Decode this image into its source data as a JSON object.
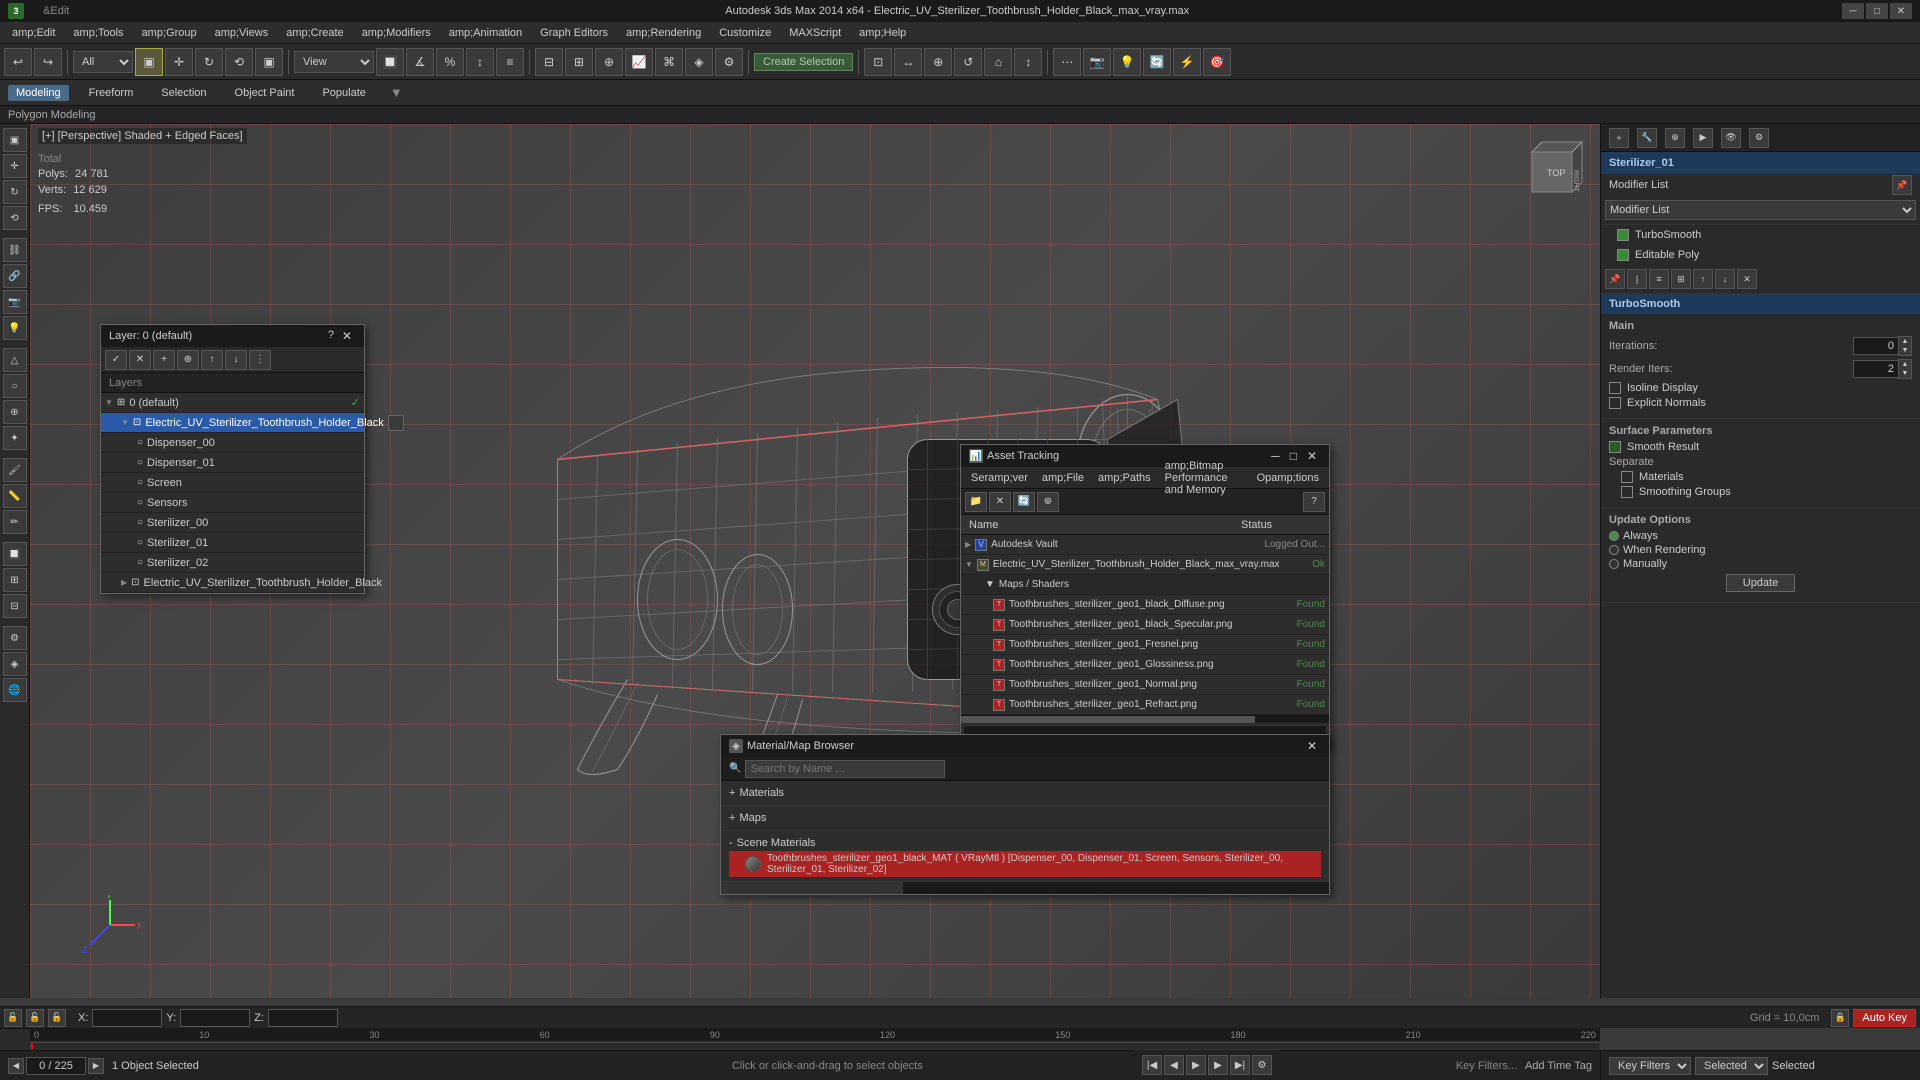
{
  "app": {
    "title": "Autodesk 3ds Max 2014 x64 - Electric_UV_Sterilizer_Toothbrush_Holder_Black_max_vray.max",
    "icon": "3dsmax-icon"
  },
  "title_bar": {
    "controls": {
      "minimize": "─",
      "maximize": "□",
      "close": "✕"
    }
  },
  "menu_bar": {
    "items": [
      "&Edit",
      "amp;Tools",
      "amp;Group",
      "amp;Views",
      "amp;Create",
      "amp;Modifiers",
      "amp;Animation",
      "Graph Editors",
      "amp;Rendering",
      "Customize",
      "MAXScript",
      "amp;Help"
    ]
  },
  "sub_toolbar": {
    "items": [
      "Modeling",
      "Freeform",
      "Selection",
      "Object Paint",
      "Populate"
    ],
    "active": "Modeling"
  },
  "poly_bar": {
    "label": "Polygon Modeling"
  },
  "viewport": {
    "label": "[+] [Perspective] Shaded + Edged Faces]",
    "stats": {
      "polys_label": "Polys:",
      "polys_value": "24 781",
      "verts_label": "Verts:",
      "verts_value": "12 629",
      "fps_label": "FPS:",
      "fps_value": "10.459",
      "total_label": "Total"
    }
  },
  "layer_dialog": {
    "title": "Layer: 0 (default)",
    "toolbar_buttons": [
      "✓",
      "✕",
      "+",
      "⊕",
      "↑",
      "↓",
      "⋮"
    ],
    "header": "Layers",
    "items": [
      {
        "id": "layer0",
        "label": "0 (default)",
        "level": 0,
        "expanded": true,
        "checked": true
      },
      {
        "id": "electric",
        "label": "Electric_UV_Sterilizer_Toothbrush_Holder_Black",
        "level": 1,
        "selected": true
      },
      {
        "id": "dispenser00",
        "label": "Dispenser_00",
        "level": 2
      },
      {
        "id": "dispenser01",
        "label": "Dispenser_01",
        "level": 2
      },
      {
        "id": "screen",
        "label": "Screen",
        "level": 2
      },
      {
        "id": "sensors",
        "label": "Sensors",
        "level": 2
      },
      {
        "id": "sterilizer00",
        "label": "Sterilizer_00",
        "level": 2
      },
      {
        "id": "sterilizer01",
        "label": "Sterilizer_01",
        "level": 2
      },
      {
        "id": "sterilizer02",
        "label": "Sterilizer_02",
        "level": 2
      },
      {
        "id": "electric2",
        "label": "Electric_UV_Sterilizer_Toothbrush_Holder_Black",
        "level": 1
      }
    ]
  },
  "asset_dialog": {
    "title": "Asset Tracking",
    "menu_items": [
      "Seramp;ver",
      "amp;File",
      "amp;Paths",
      "amp;Bitmap Performance and Memory",
      "Opamp;tions"
    ],
    "col_name": "Name",
    "col_status": "Status",
    "items": [
      {
        "id": "vault",
        "label": "Autodesk Vault",
        "level": 0,
        "type": "vault",
        "status": "Logged Out..."
      },
      {
        "id": "maxfile",
        "label": "Electric_UV_Sterilizer_Toothbrush_Holder_Black_max_vray.max",
        "level": 0,
        "type": "file",
        "status": "Ok"
      },
      {
        "id": "maps",
        "label": "Maps / Shaders",
        "level": 1,
        "type": "folder"
      },
      {
        "id": "diffuse",
        "label": "Toothbrushes_sterilizer_geo1_black_Diffuse.png",
        "level": 2,
        "type": "image",
        "status": "Found"
      },
      {
        "id": "specular",
        "label": "Toothbrushes_sterilizer_geo1_black_Specular.png",
        "level": 2,
        "type": "image",
        "status": "Found"
      },
      {
        "id": "fresnel",
        "label": "Toothbrushes_sterilizer_geo1_Fresnel.png",
        "level": 2,
        "type": "image",
        "status": "Found"
      },
      {
        "id": "glossiness",
        "label": "Toothbrushes_sterilizer_geo1_Glossiness.png",
        "level": 2,
        "type": "image",
        "status": "Found"
      },
      {
        "id": "normal",
        "label": "Toothbrushes_sterilizer_geo1_Normal.png",
        "level": 2,
        "type": "image",
        "status": "Found"
      },
      {
        "id": "refract",
        "label": "Toothbrushes_sterilizer_geo1_Refract.png",
        "level": 2,
        "type": "image",
        "status": "Found"
      }
    ]
  },
  "material_dialog": {
    "title": "Material/Map Browser",
    "search_placeholder": "Search by Name ...",
    "sections": [
      {
        "id": "materials",
        "label": "Materials",
        "expanded": false,
        "prefix": "+"
      },
      {
        "id": "maps",
        "label": "Maps",
        "expanded": false,
        "prefix": "+"
      },
      {
        "id": "scene_materials",
        "label": "Scene Materials",
        "expanded": true,
        "prefix": "-"
      }
    ],
    "scene_items": [
      {
        "label": "Toothbrushes_sterilizer_geo1_black_MAT ( VRayMtl ) [Dispenser_00, Dispenser_01, Screen, Sensors, Sterilizer_00, Sterilizer_01, Sterilizer_02]",
        "selected": true
      }
    ]
  },
  "right_panel": {
    "object_name": "Sterilizer_01",
    "modifier_list_label": "Modifier List",
    "modifiers": [
      {
        "label": "TurboSmooth",
        "active": false
      },
      {
        "label": "Editable Poly",
        "active": false
      }
    ],
    "turbosmoothSection": {
      "header": "TurboSmooth",
      "main_header": "Main",
      "iterations_label": "Iterations:",
      "iterations_value": "0",
      "render_iters_label": "Render Iters:",
      "render_iters_value": "2",
      "isoline_display": "Isoline Display",
      "explicit_normals": "Explicit Normals",
      "surface_params": "Surface Parameters",
      "smooth_result": "Smooth Result",
      "separate": "Separate",
      "materials_label": "Materials",
      "smoothing_groups": "Smoothing Groups",
      "update_options": "Update Options",
      "always": "Always",
      "when_rendering": "When Rendering",
      "manually": "Manually",
      "update_btn": "Update"
    }
  },
  "status_bar": {
    "main_text": "1 Object Selected",
    "help_text": "Click or click-and-drag to select objects"
  },
  "coord_bar": {
    "x_label": "X:",
    "y_label": "Y:",
    "z_label": "Z:",
    "grid_label": "Grid = 10,0cm",
    "auto_key": "Auto Key",
    "selected_label": "Selected"
  },
  "timeline": {
    "current": "0 / 225",
    "add_time_tag": "Add Time Tag"
  },
  "icons": {
    "expand": "▶",
    "collapse": "▼",
    "check": "✓",
    "close": "✕",
    "minimize": "─",
    "maximize": "□",
    "file": "📄",
    "folder": "📁",
    "image": "🖼",
    "sphere": "●",
    "play": "▶",
    "prev": "◀",
    "next": "▶",
    "first": "◀◀",
    "last": "▶▶"
  },
  "colors": {
    "accent_blue": "#2a5aaa",
    "accent_red": "#aa2222",
    "bg_dark": "#1a1a1a",
    "bg_medium": "#2d2d2d",
    "bg_light": "#3a3a3a",
    "text_primary": "#cccccc",
    "text_muted": "#888888",
    "status_found": "#4a8a4a",
    "selected_highlight": "#2a5aaa"
  }
}
